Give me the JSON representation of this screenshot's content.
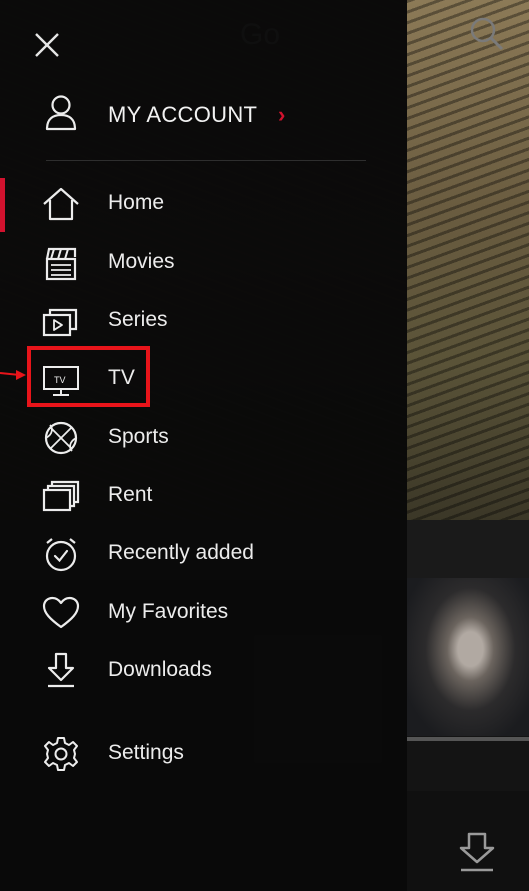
{
  "background": {
    "header_title": "Go"
  },
  "drawer": {
    "account": {
      "label": "MY ACCOUNT",
      "chevron": "›"
    },
    "items": [
      {
        "label": "Home",
        "icon": "home-icon"
      },
      {
        "label": "Movies",
        "icon": "clapperboard-icon"
      },
      {
        "label": "Series",
        "icon": "series-icon"
      },
      {
        "label": "TV",
        "icon": "tv-icon"
      },
      {
        "label": "Sports",
        "icon": "ball-icon"
      },
      {
        "label": "Rent",
        "icon": "rent-icon"
      },
      {
        "label": "Recently added",
        "icon": "clock-icon"
      },
      {
        "label": "My Favorites",
        "icon": "heart-icon"
      },
      {
        "label": "Downloads",
        "icon": "download-icon"
      },
      {
        "label": "Settings",
        "icon": "gear-icon"
      }
    ],
    "tv_icon_text": "TV",
    "active_item": "Home"
  },
  "colors": {
    "accent": "#d2122e",
    "highlight": "#e8141a"
  }
}
